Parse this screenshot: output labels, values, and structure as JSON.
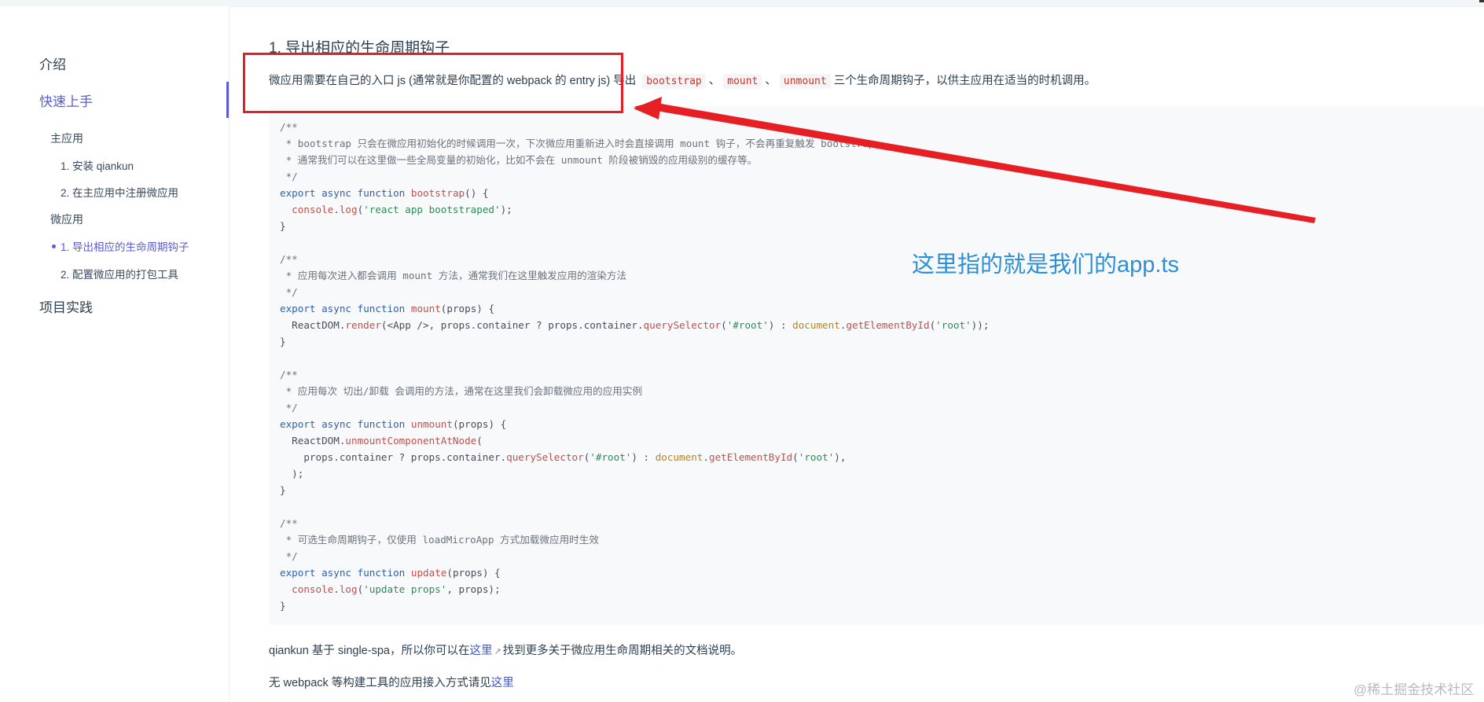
{
  "sidebar": {
    "items": [
      {
        "label": "介绍",
        "level": 1
      },
      {
        "label": "快速上手",
        "level": 1,
        "active": true
      },
      {
        "label": "主应用",
        "level": 2
      },
      {
        "label": "1. 安装 qiankun",
        "level": 3
      },
      {
        "label": "2. 在主应用中注册微应用",
        "level": 3
      },
      {
        "label": "微应用",
        "level": 2
      },
      {
        "label": "1. 导出相应的生命周期钩子",
        "level": 3,
        "active": true
      },
      {
        "label": "2. 配置微应用的打包工具",
        "level": 3
      },
      {
        "label": "项目实践",
        "level": 1
      }
    ]
  },
  "main": {
    "heading": "1. 导出相应的生命周期钩子",
    "intro": {
      "before": "微应用需要在自己的入口 js (通常就是你配置的 webpack 的 entry js) 导出",
      "code1": "bootstrap",
      "sep1": "、",
      "code2": "mount",
      "sep2": "、",
      "code3": "unmount",
      "after": "三个生命周期钩子，以供主应用在适当的时机调用。"
    },
    "code": {
      "l1": "/**",
      "l2": " * bootstrap 只会在微应用初始化的时候调用一次，下次微应用重新进入时会直接调用 mount 钩子，不会再重复触发 bootstrap。",
      "l3": " * 通常我们可以在这里做一些全局变量的初始化，比如不会在 unmount 阶段被销毁的应用级别的缓存等。",
      "l4": " */",
      "kw_export": "export",
      "kw_async": "async",
      "kw_function": "function",
      "fn_bootstrap": "bootstrap",
      "sig_empty": "() {",
      "console": "  console",
      "log": "log",
      "str_boot": "'react app bootstraped'",
      "close_call": ");",
      "brace": "}",
      "m1": "/**",
      "m2": " * 应用每次进入都会调用 mount 方法，通常我们在这里触发应用的渲染方法",
      "m3": " */",
      "fn_mount": "mount",
      "sig_props": "(props) {",
      "reactdom": "  ReactDOM",
      "render": "render",
      "render_args": "(<App />, props.container ? props.container.",
      "qs": "querySelector",
      "str_root_sel": "'#root'",
      "ternary": ") : ",
      "document": "document",
      "gebi": "getElementById",
      "str_root": "'root'",
      "end_render": "));",
      "u1": "/**",
      "u2": " * 应用每次 切出/卸载 会调用的方法，通常在这里我们会卸载微应用的应用实例",
      "u3": " */",
      "fn_unmount": "unmount",
      "ucan": "unmountComponentAtNode",
      "ucan_open": "(",
      "props_container": "    props.container ? props.container.",
      "ucan_end": "),",
      "ucan_close": "  );",
      "p1": "/**",
      "p2": " * 可选生命周期钩子，仅使用 loadMicroApp 方式加载微应用时生效",
      "p3": " */",
      "fn_update": "update",
      "str_update": "'update props'",
      "update_args": ", props);"
    },
    "para1": {
      "before": "qiankun 基于 single-spa，所以你可以在",
      "link": "这里",
      "icon": "↗",
      "after": "找到更多关于微应用生命周期相关的文档说明。"
    },
    "para2": {
      "before": "无 webpack 等构建工具的应用接入方式请见",
      "link": "这里"
    }
  },
  "annotation": {
    "text": "这里指的就是我们的app.ts",
    "box_color": "#e51f24",
    "text_color": "#2d8fd6"
  },
  "watermark": "@稀土掘金技术社区",
  "colors": {
    "accent": "#5b5bd6",
    "link": "#3e59c5"
  }
}
